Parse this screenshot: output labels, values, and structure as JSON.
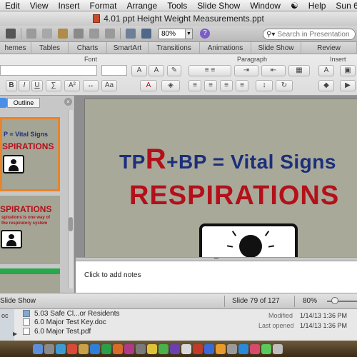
{
  "menubar": {
    "items": [
      "Edit",
      "View",
      "Insert",
      "Format",
      "Arrange",
      "Tools",
      "Slide Show",
      "Window"
    ],
    "help": "Help",
    "clock": "Sun 6:1"
  },
  "window": {
    "title": "4.01 ppt Height Weight Measurements.ppt"
  },
  "toolbar": {
    "zoom_value": "80%",
    "search_placeholder": "Search in Presentation",
    "help_glyph": "?"
  },
  "ribbon_tabs": [
    "hemes",
    "Tables",
    "Charts",
    "SmartArt",
    "Transitions",
    "Animations",
    "Slide Show",
    "Review"
  ],
  "ribbon": {
    "group_font": "Font",
    "group_paragraph": "Paragraph",
    "group_insert": "Insert",
    "bold_label": "B",
    "italic_label": "I",
    "underline_label": "U",
    "font_grow": "A",
    "font_shrink": "A",
    "text_color": "A"
  },
  "panel": {
    "outline_tab": "Outline",
    "close_glyph": "×",
    "thumb1_line1": "P = Vital Signs",
    "thumb1_line2": "SPIRATIONS",
    "thumb2_line1": "SPIRATIONS",
    "thumb2_line2": "spirations is one way of",
    "thumb2_line3": "the respiratory system"
  },
  "slide": {
    "title_part1": "TP",
    "title_big": "R",
    "title_part2": "+BP = Vital Signs",
    "subtitle": "RESPIRATIONS"
  },
  "notes": {
    "placeholder": "Click to add notes"
  },
  "status": {
    "view": "Slide Show",
    "slide_counter": "Slide 79 of 127",
    "zoom": "80%"
  },
  "finder": {
    "rows": [
      "5.03 Safe Cl...or Residents",
      "6.0 Major Test Key.doc",
      "6.0 Major Test.pdf"
    ],
    "modified_label": "Modified",
    "modified_value": "1/14/13 1:36 PM",
    "opened_label": "Last opened",
    "opened_value": "1/14/13 1:36 PM",
    "left_glyph": "oc"
  },
  "colors": {
    "slide_bg": "#a9a99a",
    "title_blue": "#1b2f7a",
    "title_red": "#b3101a",
    "tab_accent": "#4a8ee8"
  }
}
